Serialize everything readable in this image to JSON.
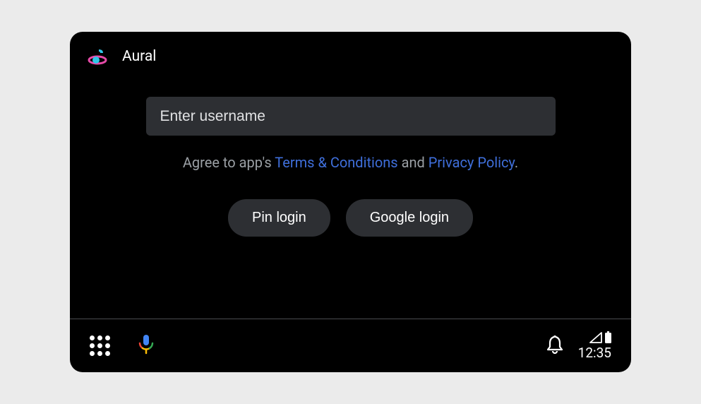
{
  "header": {
    "app_name": "Aural"
  },
  "login": {
    "username_placeholder": "Enter username",
    "agreement_prefix": "Agree to app's ",
    "terms_label": "Terms & Conditions",
    "agreement_middle": " and ",
    "privacy_label": "Privacy Policy",
    "agreement_suffix": ".",
    "pin_button": "Pin login",
    "google_button": "Google login"
  },
  "statusbar": {
    "clock": "12:35"
  }
}
